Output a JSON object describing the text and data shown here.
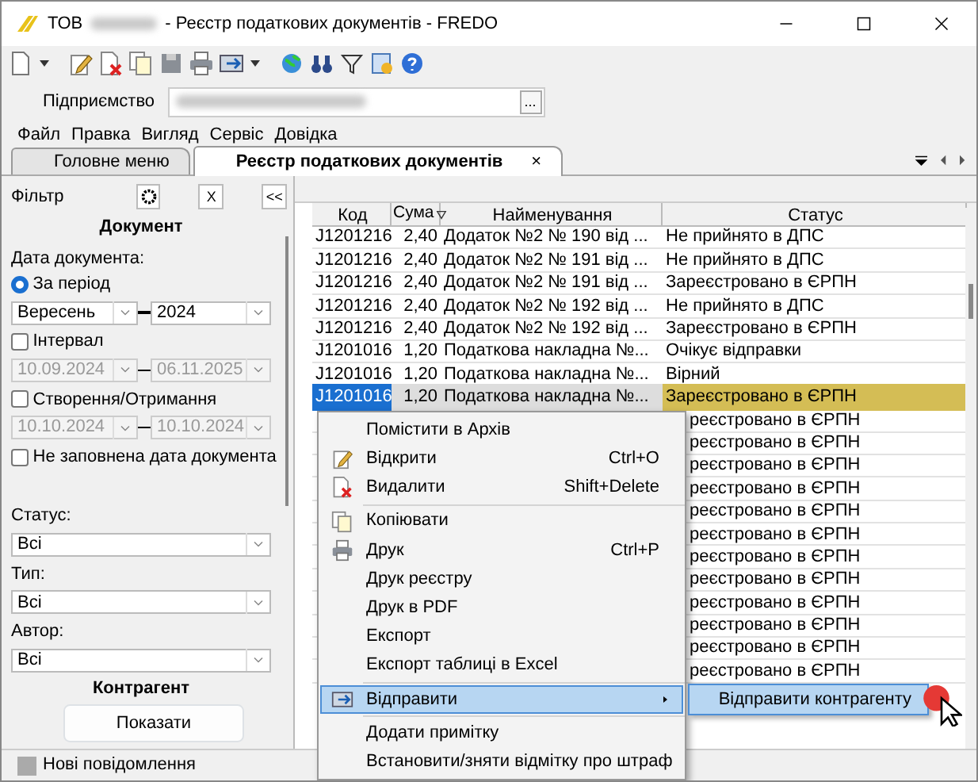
{
  "window": {
    "title_prefix": "ТОВ",
    "title_suffix": "- Реєстр податкових документів - FREDO"
  },
  "enterprise": {
    "label": "Підприємство",
    "button": "..."
  },
  "menu": [
    "Файл",
    "Правка",
    "Вигляд",
    "Сервіс",
    "Довідка"
  ],
  "tabs": [
    {
      "label": "Головне меню",
      "selected": false
    },
    {
      "label": "Реєстр податкових документів",
      "selected": true,
      "close": "×"
    }
  ],
  "filter": {
    "title": "Фільтр",
    "close": "X",
    "collapse": "<<",
    "section": "Документ",
    "date_label": "Дата документа:",
    "period": {
      "label": "За період",
      "selected": true,
      "month": "Вересень",
      "year": "2024"
    },
    "interval": {
      "label": "Інтервал",
      "checked": false,
      "from": "10.09.2024",
      "to": "06.11.2025"
    },
    "created": {
      "label": "Створення/Отримання",
      "checked": false,
      "from": "10.10.2024",
      "to": "10.10.2024"
    },
    "no_date": {
      "label": "Не заповнена дата документа",
      "checked": false
    },
    "selects": [
      {
        "label": "Статус:",
        "value": "Всі"
      },
      {
        "label": "Тип:",
        "value": "Всі"
      },
      {
        "label": "Автор:",
        "value": "Всі"
      }
    ],
    "section2": "Контрагент",
    "show_button": "Показати"
  },
  "table": {
    "columns": [
      "Код",
      "Сума",
      "Найменування",
      "Статус"
    ],
    "rows": [
      {
        "code": "J1201216",
        "sum": "2,40",
        "name": "Додаток №2 № 190 від ...",
        "status": "Не прийнято в ДПС",
        "selected": false
      },
      {
        "code": "J1201216",
        "sum": "2,40",
        "name": "Додаток №2 № 191 від ...",
        "status": "Не прийнято в ДПС",
        "selected": false
      },
      {
        "code": "J1201216",
        "sum": "2,40",
        "name": "Додаток №2 № 191 від ...",
        "status": "Зареєстровано в ЄРПН",
        "selected": false
      },
      {
        "code": "J1201216",
        "sum": "2,40",
        "name": "Додаток №2 № 192 від ...",
        "status": "Не прийнято в ДПС",
        "selected": false
      },
      {
        "code": "J1201216",
        "sum": "2,40",
        "name": "Додаток №2 № 192 від ...",
        "status": "Зареєстровано в ЄРПН",
        "selected": false
      },
      {
        "code": "J1201016",
        "sum": "1,20",
        "name": "Податкова накладна №...",
        "status": "Очікує відправки",
        "selected": false
      },
      {
        "code": "J1201016",
        "sum": "1,20",
        "name": "Податкова накладна №...",
        "status": "Вірний",
        "selected": false
      },
      {
        "code": "J1201016",
        "sum": "1,20",
        "name": "Податкова накладна №...",
        "status": "Зареєстровано в ЄРПН",
        "selected": true
      },
      {
        "status": "реєстровано в ЄРПН",
        "selected": false
      },
      {
        "status": "реєстровано в ЄРПН",
        "selected": false
      },
      {
        "status": "реєстровано в ЄРПН",
        "selected": false
      },
      {
        "status": "реєстровано в ЄРПН",
        "selected": false
      },
      {
        "status": "реєстровано в ЄРПН",
        "selected": false
      },
      {
        "status": "реєстровано в ЄРПН",
        "selected": false
      },
      {
        "status": "реєстровано в ЄРПН",
        "selected": false
      },
      {
        "status": "реєстровано в ЄРПН",
        "selected": false
      },
      {
        "status": "реєстровано в ЄРПН",
        "selected": false
      },
      {
        "status": "реєстровано в ЄРПН",
        "selected": false
      },
      {
        "status": "реєстровано в ЄРПН",
        "selected": false
      },
      {
        "status": "реєстровано в ЄРПН",
        "selected": false
      }
    ]
  },
  "context_menu": [
    {
      "label": "Помістити в Архів",
      "highlighted": false
    },
    {
      "label": "Відкрити",
      "shortcut": "Ctrl+O",
      "kind": "edit",
      "highlighted": false
    },
    {
      "label": "Видалити",
      "shortcut": "Shift+Delete",
      "kind": "delete",
      "highlighted": false
    },
    {
      "label": "Копіювати",
      "kind": "copy",
      "separator_before": true,
      "highlighted": false
    },
    {
      "label": "Друк",
      "shortcut": "Ctrl+P",
      "kind": "print",
      "highlighted": false
    },
    {
      "label": "Друк реєстру",
      "highlighted": false
    },
    {
      "label": "Друк в PDF",
      "highlighted": false
    },
    {
      "label": "Експорт",
      "highlighted": false
    },
    {
      "label": "Експорт таблиці в Excel",
      "highlighted": false
    },
    {
      "label": "Відправити",
      "kind": "send",
      "separator_before": true,
      "highlighted": true,
      "submenu": [
        "Відправити контрагенту"
      ]
    },
    {
      "label": "Додати примітку",
      "separator_before": true,
      "highlighted": false
    },
    {
      "label": "Встановити/зняти відмітку про штраф",
      "highlighted": false
    }
  ],
  "status_bar": {
    "text": "Нові повідомлення"
  }
}
